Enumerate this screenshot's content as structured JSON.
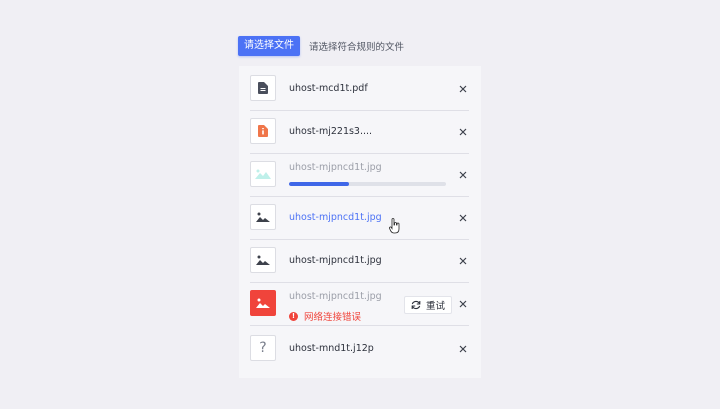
{
  "toolbar": {
    "select_label": "请选择文件",
    "hint": "请选择符合规则的文件"
  },
  "files": [
    {
      "name": "uhost-mcd1t.pdf",
      "icon": "pdf-file-icon",
      "state": "done"
    },
    {
      "name": "uhost-mj221s3....",
      "icon": "archive-file-icon",
      "state": "done"
    },
    {
      "name": "uhost-mjpncd1t.jpg",
      "icon": "image-loading-icon",
      "state": "uploading",
      "progress": 0.38
    },
    {
      "name": "uhost-mjpncd1t.jpg",
      "icon": "image-icon",
      "state": "hover"
    },
    {
      "name": "uhost-mjpncd1t.jpg",
      "icon": "image-icon",
      "state": "done"
    },
    {
      "name": "uhost-mjpncd1t.jpg",
      "icon": "image-error-icon",
      "state": "error",
      "error_text": "网络连接错误",
      "retry_label": "重试"
    },
    {
      "name": "uhost-mnd1t.j12p",
      "icon": "unknown-file-icon",
      "state": "done",
      "glyph": "?"
    }
  ],
  "colors": {
    "accent": "#4c72f5",
    "error": "#f0443b",
    "progress": "#3f67e8"
  }
}
